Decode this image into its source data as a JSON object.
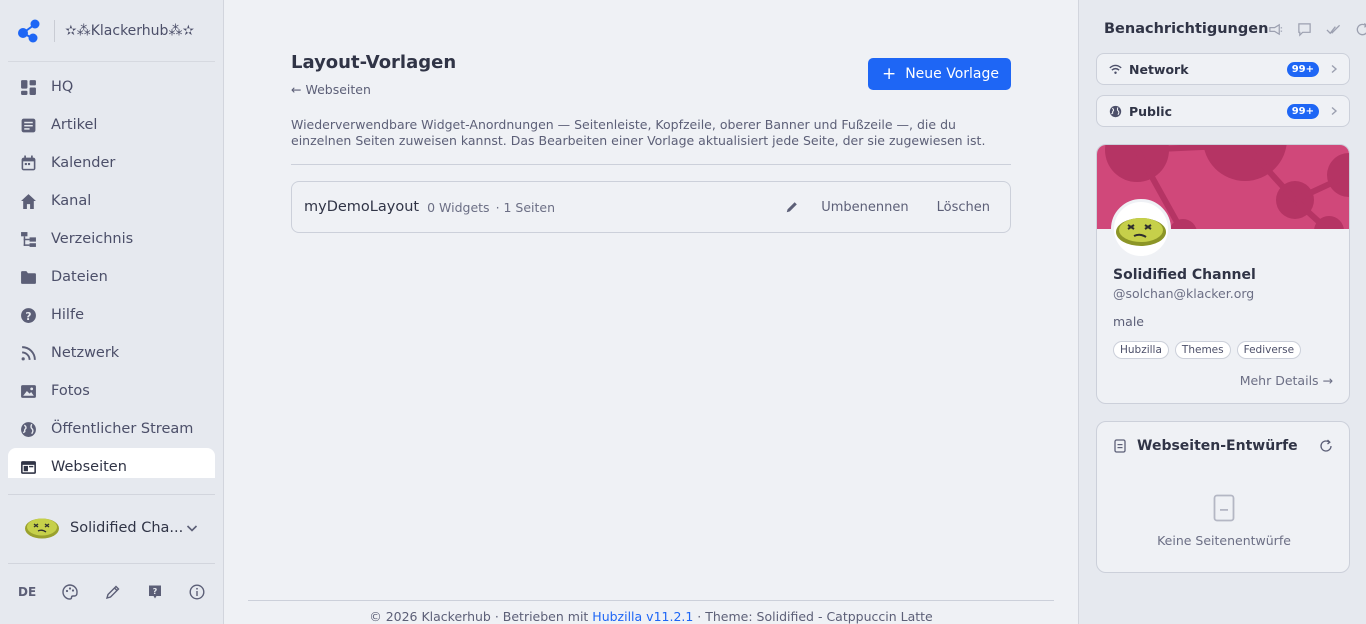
{
  "brand": {
    "name": "✫⁂Klackerhub⁂✫"
  },
  "nav": {
    "items": [
      {
        "label": "HQ",
        "icon": "dashboard-icon"
      },
      {
        "label": "Artikel",
        "icon": "article-icon"
      },
      {
        "label": "Kalender",
        "icon": "calendar-icon"
      },
      {
        "label": "Kanal",
        "icon": "home-icon"
      },
      {
        "label": "Verzeichnis",
        "icon": "directory-icon"
      },
      {
        "label": "Dateien",
        "icon": "folder-icon"
      },
      {
        "label": "Hilfe",
        "icon": "help-icon"
      },
      {
        "label": "Netzwerk",
        "icon": "rss-icon"
      },
      {
        "label": "Fotos",
        "icon": "image-icon"
      },
      {
        "label": "Öffentlicher Stream",
        "icon": "globe-icon"
      },
      {
        "label": "Webseiten",
        "icon": "webpage-icon"
      }
    ],
    "active": "Webseiten"
  },
  "account": {
    "name": "Solidified Cha..."
  },
  "bottom": {
    "lang": "DE"
  },
  "main": {
    "title": "Layout-Vorlagen",
    "back_link": "← Webseiten",
    "new_button": "Neue Vorlage",
    "description": "Wiederverwendbare Widget-Anordnungen — Seitenleiste, Kopfzeile, oberer Banner und Fußzeile —, die du einzelnen Seiten zuweisen kannst. Das Bearbeiten einer Vorlage aktualisiert jede Seite, der sie zugewiesen ist.",
    "layouts": [
      {
        "name": "myDemoLayout",
        "widgets": "0 Widgets",
        "pages": "· 1 Seiten",
        "rename": "Umbenennen",
        "delete": "Löschen"
      }
    ]
  },
  "footer": {
    "prefix": "© 2026 Klackerhub · Betrieben mit ",
    "link": "Hubzilla v11.2.1",
    "suffix": " · Theme: Solidified - Catppuccin Latte"
  },
  "notifications": {
    "title": "Benachrichtigungen",
    "channels": [
      {
        "label": "Network",
        "badge": "99+"
      },
      {
        "label": "Public",
        "badge": "99+"
      }
    ]
  },
  "profile": {
    "name": "Solidified Channel",
    "handle": "@solchan@klacker.org",
    "gender": "male",
    "tags": [
      "Hubzilla",
      "Themes",
      "Fediverse"
    ],
    "more": "Mehr Details →"
  },
  "drafts": {
    "title": "Webseiten-Entwürfe",
    "empty": "Keine Seitenentwürfe"
  },
  "colors": {
    "accent": "#1e66f5",
    "banner": "#d0487a",
    "online": "#40a02b"
  }
}
